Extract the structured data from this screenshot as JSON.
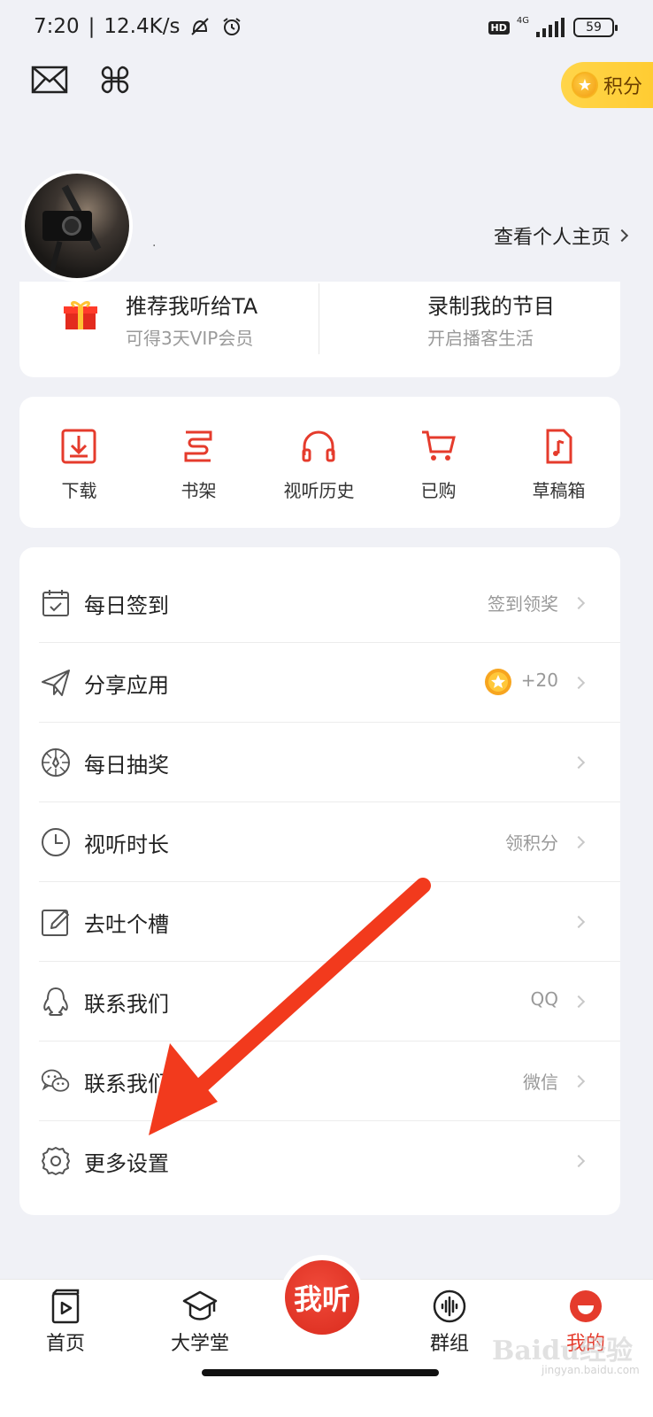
{
  "status_bar": {
    "time": "7:20",
    "speed": "12.4K/s",
    "hd": "HD",
    "network": "4G",
    "battery": "59"
  },
  "header": {
    "points_label": "积分"
  },
  "profile": {
    "username": ".",
    "view_homepage": "查看个人主页"
  },
  "promo": {
    "left": {
      "title": "推荐我听给TA",
      "subtitle": "可得3天VIP会员"
    },
    "right": {
      "title": "录制我的节目",
      "subtitle": "开启播客生活"
    }
  },
  "shortcuts": [
    {
      "label": "下载",
      "icon": "download-icon"
    },
    {
      "label": "书架",
      "icon": "bookshelf-icon"
    },
    {
      "label": "视听历史",
      "icon": "headphones-icon"
    },
    {
      "label": "已购",
      "icon": "cart-icon"
    },
    {
      "label": "草稿箱",
      "icon": "draft-music-icon"
    }
  ],
  "menu": [
    {
      "label": "每日签到",
      "value": "签到领奖",
      "icon": "calendar-check-icon"
    },
    {
      "label": "分享应用",
      "value": "+20",
      "icon": "paper-plane-icon"
    },
    {
      "label": "每日抽奖",
      "value": "",
      "icon": "lottery-wheel-icon"
    },
    {
      "label": "视听时长",
      "value": "领积分",
      "icon": "clock-icon"
    },
    {
      "label": "去吐个槽",
      "value": "",
      "icon": "edit-icon"
    },
    {
      "label": "联系我们",
      "value": "QQ",
      "icon": "qq-icon"
    },
    {
      "label": "联系我们",
      "value": "微信",
      "icon": "wechat-icon"
    },
    {
      "label": "更多设置",
      "value": "",
      "icon": "settings-gear-icon"
    }
  ],
  "bottom_nav": {
    "home": "首页",
    "university": "大学堂",
    "center": "我听",
    "groups": "群组",
    "mine": "我的"
  },
  "watermark": {
    "brand": "Baidu经验",
    "domain": "jingyan.baidu.com"
  },
  "colors": {
    "accent": "#e53b2c",
    "points_gold": "#ffcb2f",
    "background": "#f0f1f6",
    "arrow": "#f23a1d"
  }
}
